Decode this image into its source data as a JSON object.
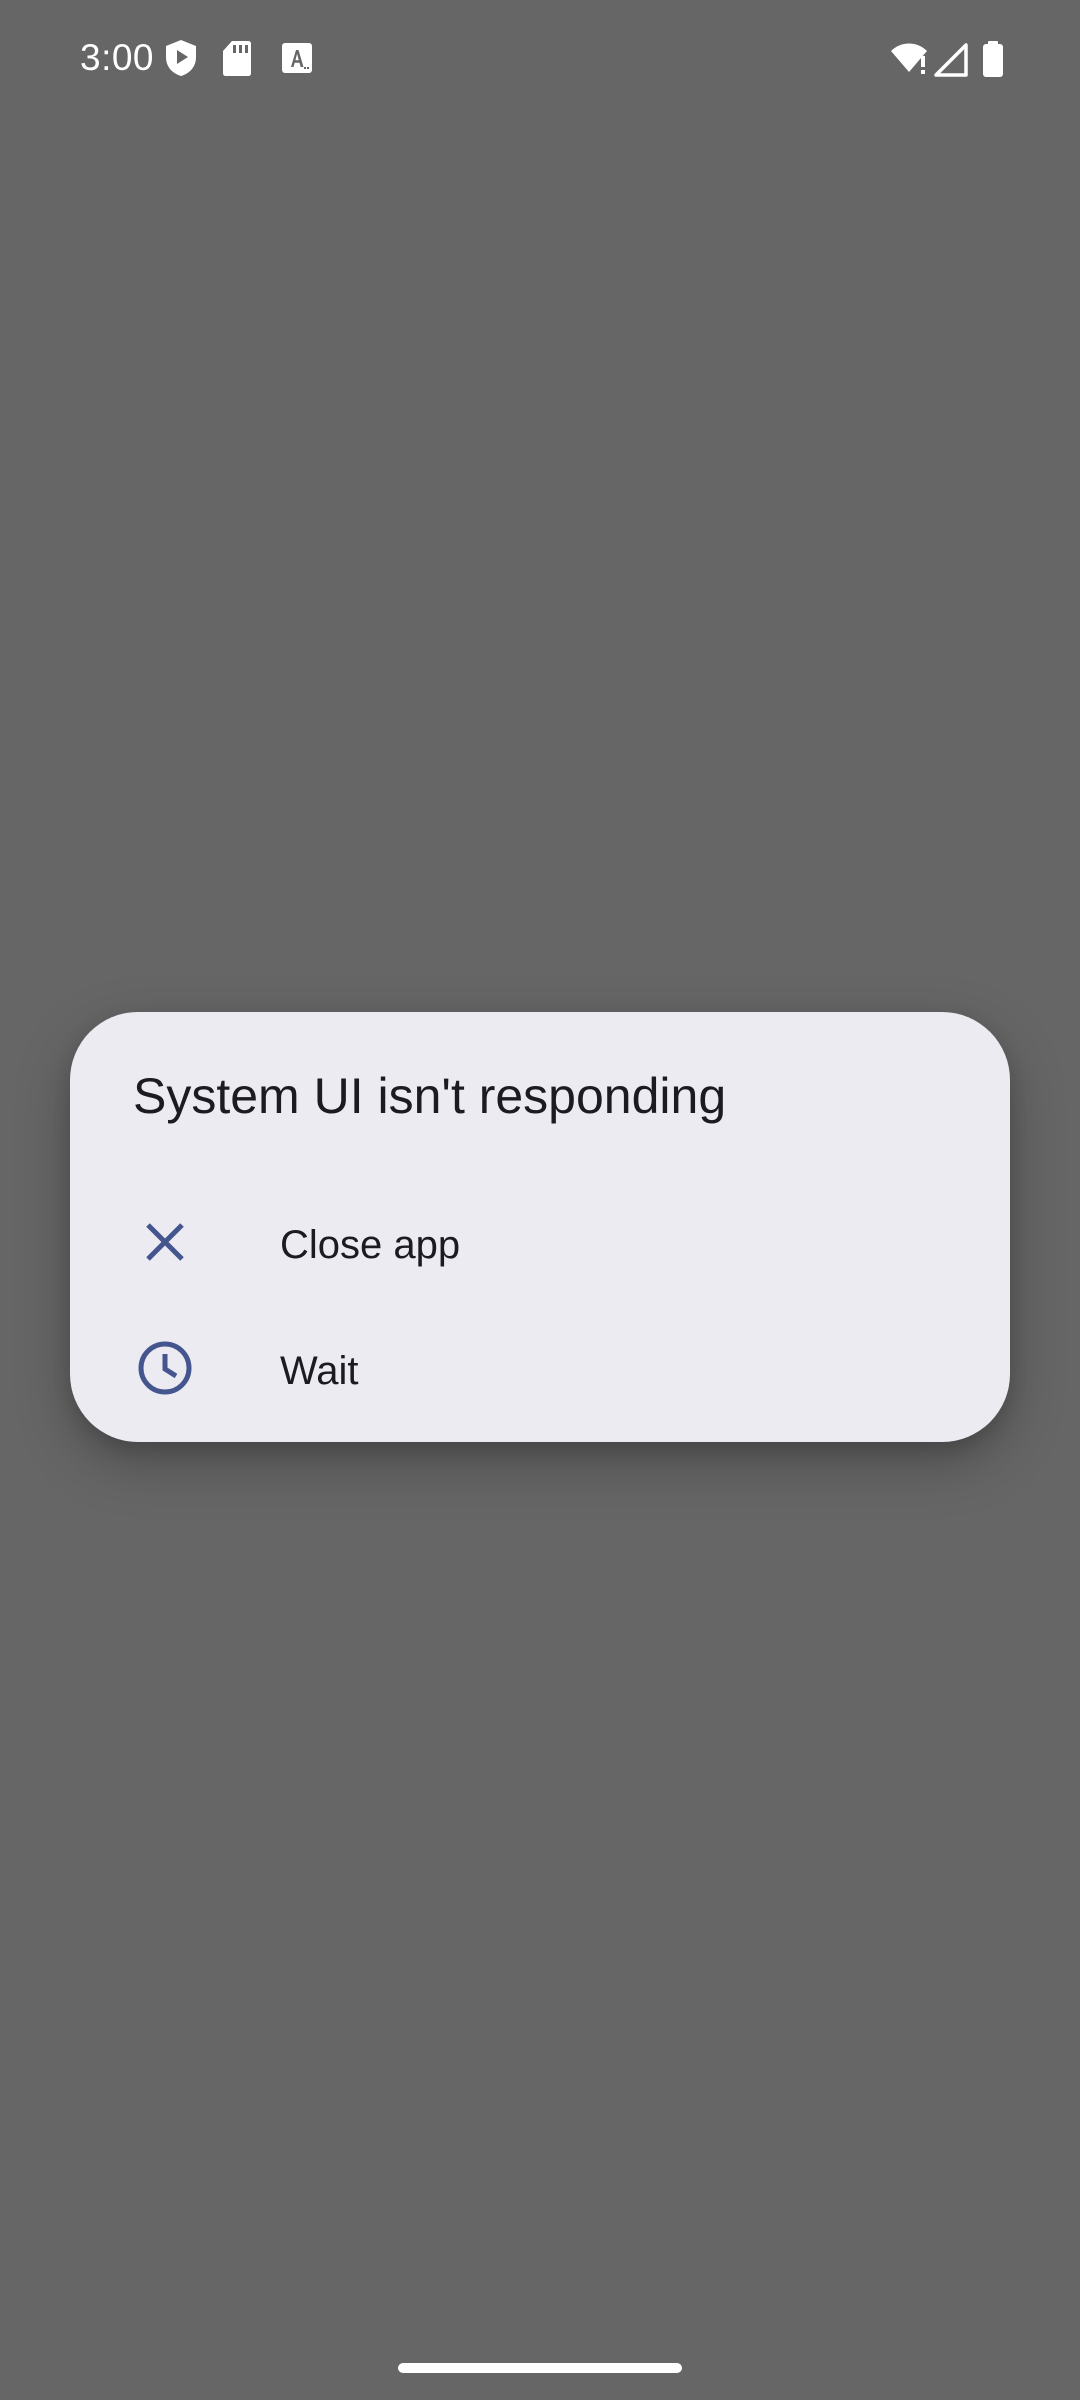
{
  "status_bar": {
    "time": "3:00",
    "left_icons": [
      "play-protect-icon",
      "sd-card-icon",
      "text-input-icon"
    ],
    "right_icons": [
      "wifi-alert-icon",
      "cellular-signal-icon",
      "battery-icon"
    ]
  },
  "dialog": {
    "title": "System UI isn't responding",
    "options": [
      {
        "label": "Close app",
        "icon": "close-icon"
      },
      {
        "label": "Wait",
        "icon": "clock-icon"
      }
    ]
  },
  "colors": {
    "background": "#666666",
    "dialog_surface": "#ecebf2",
    "text_primary": "#1b1b20",
    "icon_accent": "#45568f",
    "status_foreground": "#ffffff"
  }
}
